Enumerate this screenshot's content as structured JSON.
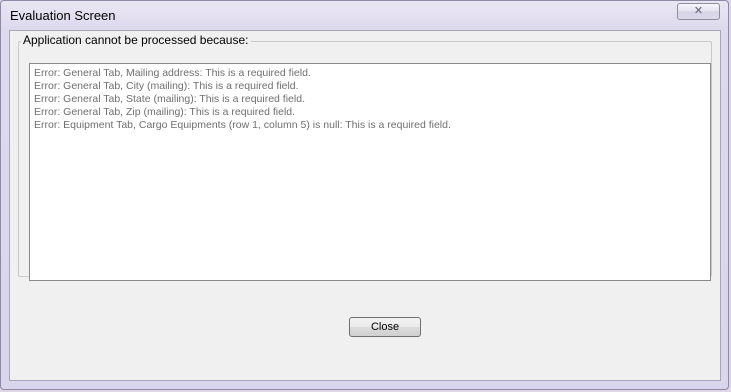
{
  "window": {
    "title": "Evaluation Screen",
    "close_glyph": "✕"
  },
  "group": {
    "label": "Application cannot be processed because:"
  },
  "errors": [
    "Error: General Tab, Mailing address: This is a required field.",
    "Error: General Tab, City (mailing): This is a required field.",
    "Error: General Tab, State (mailing): This is a required field.",
    "Error: General Tab, Zip (mailing): This is a required field.",
    "Error: Equipment Tab, Cargo Equipments (row 1, column 5) is null: This is a required field."
  ],
  "buttons": {
    "close_label": "Close"
  }
}
